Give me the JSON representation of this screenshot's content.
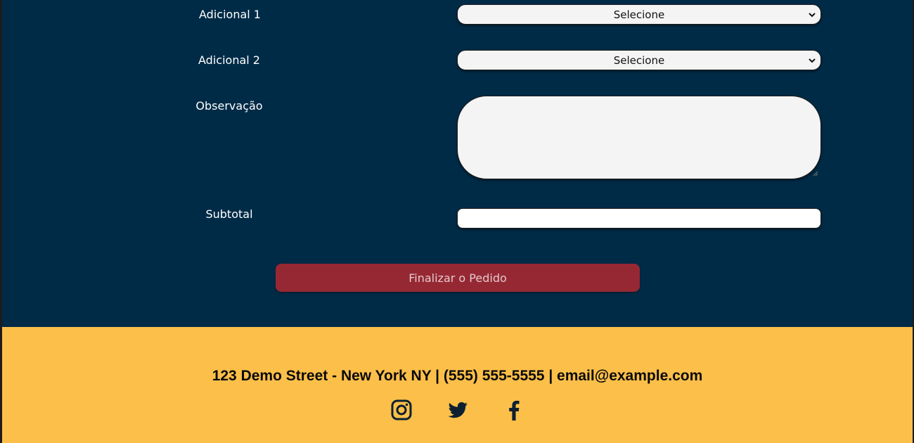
{
  "form": {
    "adicional1_label": "Adicional 1",
    "adicional1_value": "Selecione",
    "adicional2_label": "Adicional 2",
    "adicional2_value": "Selecione",
    "observacao_label": "Observação",
    "observacao_value": "",
    "subtotal_label": "Subtotal",
    "subtotal_value": "",
    "submit_label": "Finalizar o Pedido"
  },
  "footer": {
    "contact": "123 Demo Street - New York NY | (555) 555-5555 | email@example.com",
    "social_icons": [
      "instagram-icon",
      "twitter-icon",
      "facebook-icon"
    ]
  },
  "colors": {
    "form_background": "#002b47",
    "footer_background": "#fcbf49",
    "submit_button": "#962833"
  }
}
